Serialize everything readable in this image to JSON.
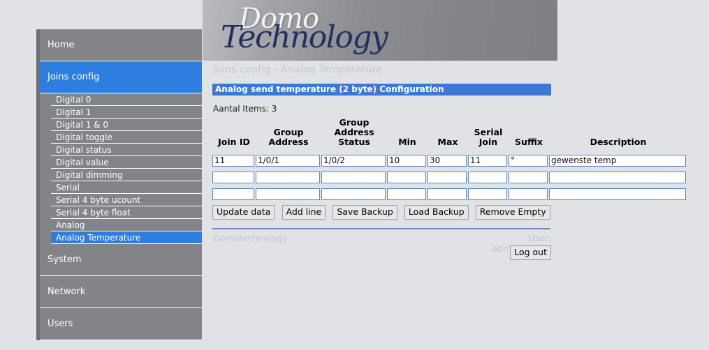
{
  "brand": {
    "logo_top": "Domo",
    "logo_bottom": "Technology",
    "accent_blue": "#2e7de0",
    "title_bar_blue": "#3b79d4",
    "sidebar_gray": "#828487",
    "page_background": "#e0e2e6"
  },
  "sidebar": {
    "items": [
      {
        "label": "Home",
        "type": "main",
        "active": false
      },
      {
        "label": "Joins config",
        "type": "main",
        "active": true
      },
      {
        "label": "Digital 0",
        "type": "sub",
        "active": false
      },
      {
        "label": "Digital 1",
        "type": "sub",
        "active": false
      },
      {
        "label": "Digital 1 & 0",
        "type": "sub",
        "active": false
      },
      {
        "label": "Digital toggle",
        "type": "sub",
        "active": false
      },
      {
        "label": "Digital status",
        "type": "sub",
        "active": false
      },
      {
        "label": "Digital value",
        "type": "sub",
        "active": false
      },
      {
        "label": "Digital dimming",
        "type": "sub",
        "active": false
      },
      {
        "label": "Serial",
        "type": "sub",
        "active": false
      },
      {
        "label": "Serial 4 byte ucount",
        "type": "sub",
        "active": false
      },
      {
        "label": "Serial 4 byte float",
        "type": "sub",
        "active": false
      },
      {
        "label": "Analog",
        "type": "sub",
        "active": false
      },
      {
        "label": "Analog Temperature",
        "type": "sub",
        "active": true
      },
      {
        "label": "System",
        "type": "main",
        "active": false
      },
      {
        "label": "Network",
        "type": "main",
        "active": false
      },
      {
        "label": "Users",
        "type": "main",
        "active": false
      }
    ]
  },
  "main": {
    "breadcrumb": "Joins config - Analog Temperature",
    "section_title": "Analog send temperature (2 byte) Configuration",
    "item_count_label": "Aantal Items: 3",
    "columns": [
      "Join ID",
      "Group Address",
      "Group Address Status",
      "Min",
      "Max",
      "Serial Join",
      "Suffix",
      "Description"
    ],
    "rows": [
      {
        "join_id": "11",
        "group_address": "1/0/1",
        "group_address_status": "1/0/2",
        "min": "10",
        "max": "30",
        "serial_join": "11",
        "suffix": "°",
        "description": "gewenste temp"
      },
      {
        "join_id": "",
        "group_address": "",
        "group_address_status": "",
        "min": "",
        "max": "",
        "serial_join": "",
        "suffix": "",
        "description": ""
      },
      {
        "join_id": "",
        "group_address": "",
        "group_address_status": "",
        "min": "",
        "max": "",
        "serial_join": "",
        "suffix": "",
        "description": ""
      }
    ],
    "buttons": [
      "Update data",
      "Add line",
      "Save Backup",
      "Load Backup",
      "Remove Empty"
    ]
  },
  "footer": {
    "company": "Domotechnology",
    "user": "User: administrator",
    "logout_label": "Log out"
  }
}
